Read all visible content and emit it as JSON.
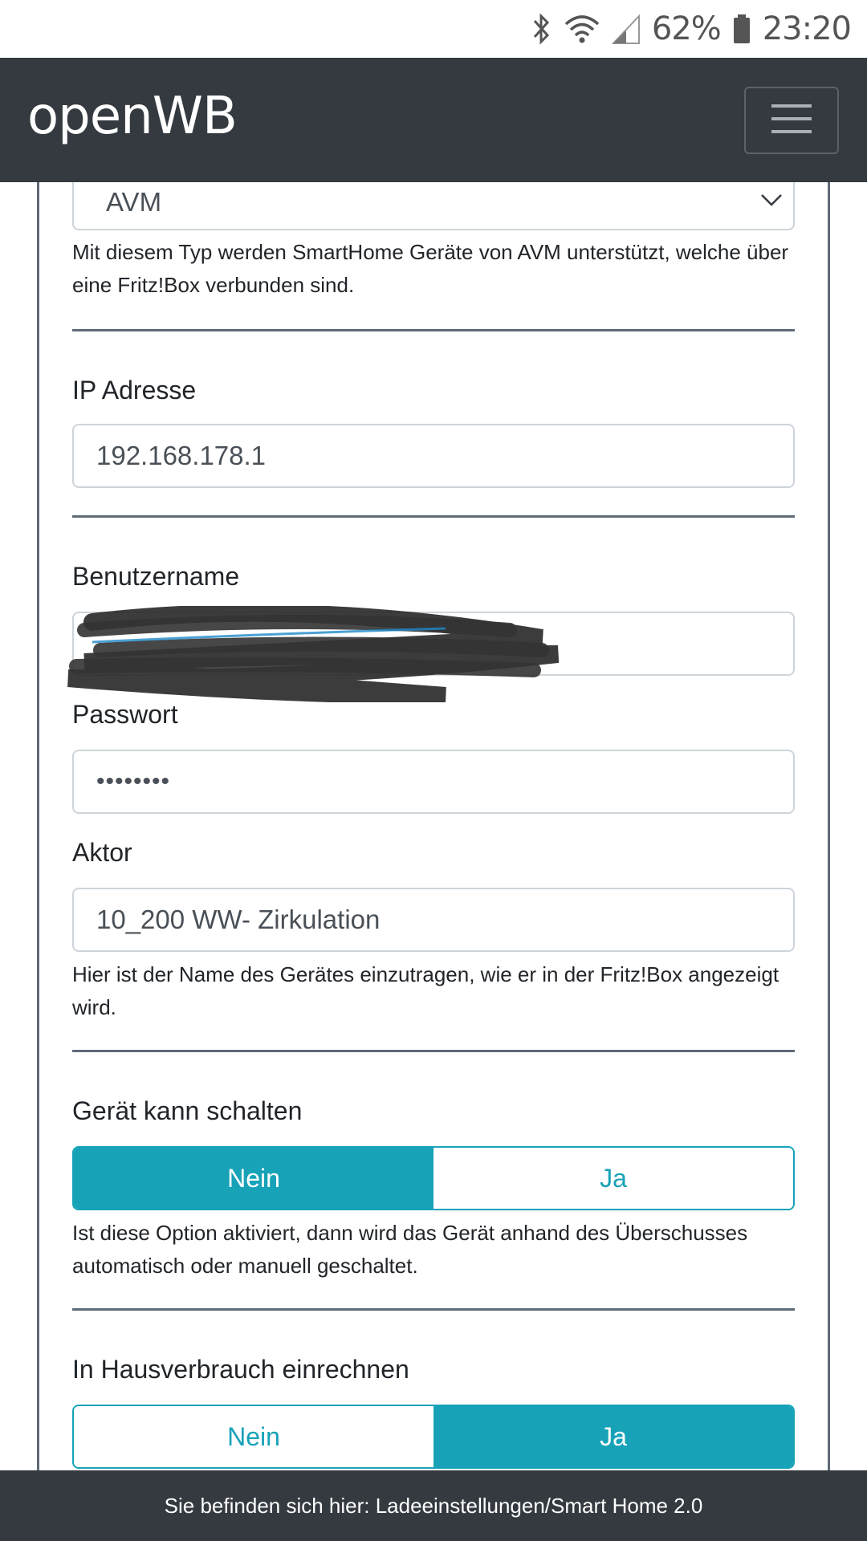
{
  "status_bar": {
    "battery_percent": "62%",
    "time": "23:20",
    "icons": [
      "bluetooth-icon",
      "wifi-icon",
      "signal-icon",
      "battery-icon"
    ]
  },
  "navbar": {
    "brand": "openWB",
    "menu_icon": "hamburger-menu-icon"
  },
  "device_type": {
    "selected": "AVM",
    "help": "Mit diesem Typ werden SmartHome Geräte von AVM unterstützt, welche über eine Fritz!Box verbunden sind."
  },
  "ip_address": {
    "label": "IP Adresse",
    "value": "192.168.178.1"
  },
  "username": {
    "label": "Benutzername",
    "value": ""
  },
  "password": {
    "label": "Passwort",
    "value": "••••••••"
  },
  "actor": {
    "label": "Aktor",
    "value": "10_200 WW- Zirkulation",
    "help": "Hier ist der Name des Gerätes einzutragen, wie er in der Fritz!Box angezeigt wird."
  },
  "can_switch": {
    "label": "Gerät kann schalten",
    "options": [
      "Nein",
      "Ja"
    ],
    "selected": "Nein",
    "help": "Ist diese Option aktiviert, dann wird das Gerät anhand des Überschusses automatisch oder manuell geschaltet."
  },
  "house_consumption": {
    "label": "In Hausverbrauch einrechnen",
    "options": [
      "Nein",
      "Ja"
    ],
    "selected": "Ja"
  },
  "footer": {
    "text": "Sie befinden sich hier: Ladeeinstellungen/Smart Home 2.0"
  },
  "colors": {
    "navbar": "#343a40",
    "accent": "#17a2b8",
    "divider": "#5f6b76"
  }
}
